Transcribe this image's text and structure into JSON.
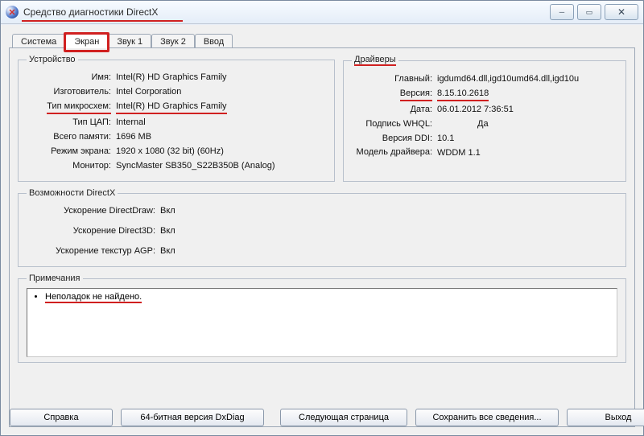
{
  "window": {
    "title": "Средство диагностики DirectX",
    "icon_glyph": "✖"
  },
  "tabs": {
    "items": [
      {
        "label": "Система",
        "active": false
      },
      {
        "label": "Экран",
        "active": true
      },
      {
        "label": "Звук 1",
        "active": false
      },
      {
        "label": "Звук 2",
        "active": false
      },
      {
        "label": "Ввод",
        "active": false
      }
    ]
  },
  "device": {
    "legend": "Устройство",
    "name_k": "Имя:",
    "name_v": "Intel(R) HD Graphics Family",
    "vendor_k": "Изготовитель:",
    "vendor_v": "Intel Corporation",
    "chip_k": "Тип микросхем:",
    "chip_v": "Intel(R) HD Graphics Family",
    "dac_k": "Тип ЦАП:",
    "dac_v": "Internal",
    "mem_k": "Всего памяти:",
    "mem_v": "1696 MB",
    "mode_k": "Режим экрана:",
    "mode_v": "1920 x 1080 (32 bit) (60Hz)",
    "monitor_k": "Монитор:",
    "monitor_v": "SyncMaster SB350_S22B350B (Analog)"
  },
  "drivers": {
    "legend": "Драйверы",
    "main_k": "Главный:",
    "main_v": "igdumd64.dll,igd10umd64.dll,igd10u",
    "ver_k": "Версия:",
    "ver_v": "8.15.10.2618",
    "date_k": "Дата:",
    "date_v": "06.01.2012 7:36:51",
    "whql_k": "Подпись WHQL:",
    "whql_v": "Да",
    "ddi_k": "Версия DDI:",
    "ddi_v": "10.1",
    "model_k": "Модель драйвера:",
    "model_v": "WDDM 1.1"
  },
  "dxcaps": {
    "legend": "Возможности DirectX",
    "dd_k": "Ускорение DirectDraw:",
    "dd_v": "Вкл",
    "d3d_k": "Ускорение Direct3D:",
    "d3d_v": "Вкл",
    "agp_k": "Ускорение текстур AGP:",
    "agp_v": "Вкл"
  },
  "notes": {
    "legend": "Примечания",
    "item0": "Неполадок не найдено."
  },
  "buttons": {
    "help": "Справка",
    "bit64": "64-битная версия DxDiag",
    "next": "Следующая страница",
    "save": "Сохранить все сведения...",
    "exit": "Выход"
  }
}
